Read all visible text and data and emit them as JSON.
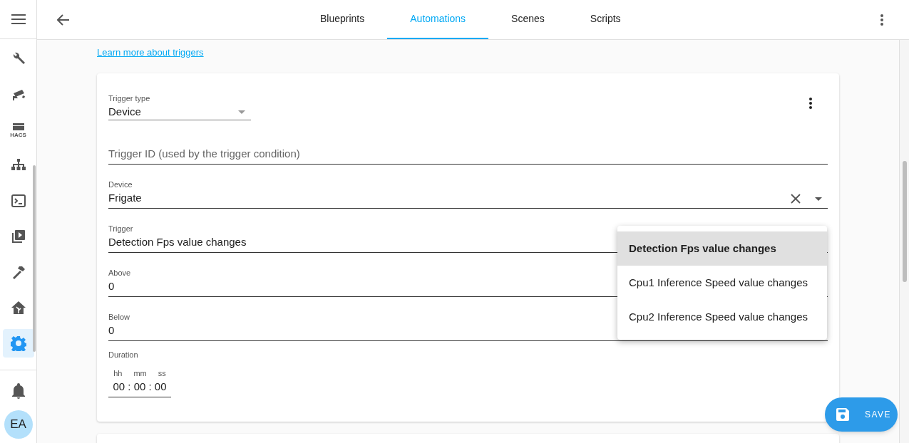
{
  "sidebar": {
    "items": [
      {
        "kind": "wrench",
        "selected": false
      },
      {
        "kind": "camera",
        "selected": false
      },
      {
        "kind": "store",
        "label": "HACS",
        "selected": false
      },
      {
        "kind": "network",
        "selected": false
      },
      {
        "kind": "terminal",
        "selected": false
      },
      {
        "kind": "media",
        "selected": false
      },
      {
        "kind": "hammer",
        "selected": false
      },
      {
        "kind": "home",
        "selected": false
      },
      {
        "kind": "gear",
        "selected": true
      }
    ],
    "avatar": "EA"
  },
  "tabs": [
    {
      "label": "Blueprints",
      "selected": false
    },
    {
      "label": "Automations",
      "selected": true
    },
    {
      "label": "Scenes",
      "selected": false
    },
    {
      "label": "Scripts",
      "selected": false
    }
  ],
  "learn_link": "Learn more about triggers",
  "trigger_card": {
    "trigger_type": {
      "label": "Trigger type",
      "value": "Device"
    },
    "fields": [
      {
        "kind": "text",
        "placeholder": "Trigger ID (used by the trigger condition)"
      },
      {
        "kind": "clearable",
        "label": "Device",
        "value": "Frigate"
      },
      {
        "kind": "text",
        "label": "Trigger",
        "value": "Detection Fps value changes"
      },
      {
        "kind": "text",
        "label": "Above",
        "value": "0"
      },
      {
        "kind": "text",
        "label": "Below",
        "value": "0"
      }
    ],
    "duration": {
      "label": "Duration",
      "units": [
        "hh",
        "mm",
        "ss"
      ],
      "value": "00 : 00 : 00"
    }
  },
  "menu": [
    {
      "label": "Detection Fps value changes",
      "selected": true
    },
    {
      "label": "Cpu1 Inference Speed value changes",
      "selected": false
    },
    {
      "label": "Cpu2 Inference Speed value changes",
      "selected": false
    }
  ],
  "save_button": "SAVE"
}
